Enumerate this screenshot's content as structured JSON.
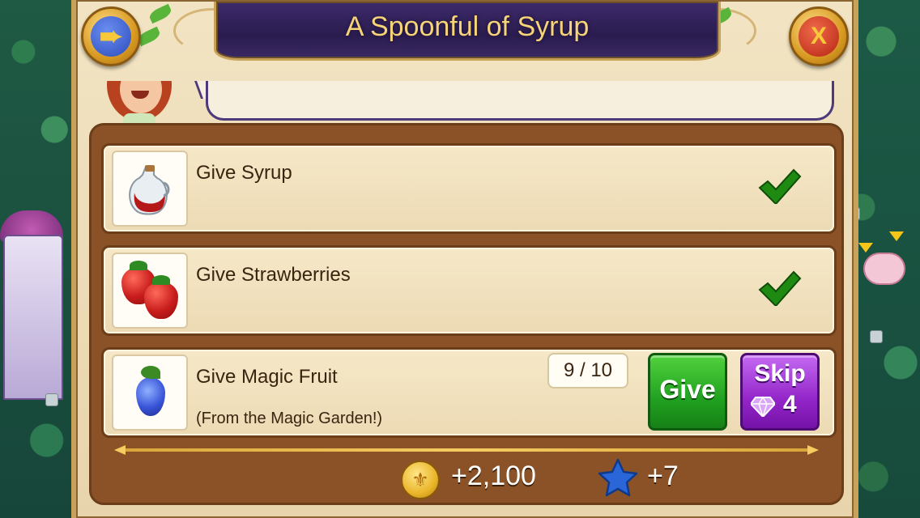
{
  "title": "A Spoonful of Syrup",
  "buttons": {
    "back_icon": "back-arrow-icon",
    "close_label": "X"
  },
  "tasks": [
    {
      "label": "Give Syrup",
      "item_icon": "syrup-bottle-icon",
      "completed": true
    },
    {
      "label": "Give Strawberries",
      "item_icon": "strawberries-icon",
      "completed": true
    },
    {
      "label": "Give Magic Fruit",
      "subtitle": "(From the Magic Garden!)",
      "item_icon": "magic-fruit-icon",
      "completed": false,
      "progress": "9 / 10",
      "give_label": "Give",
      "skip_label": "Skip",
      "skip_cost": "4"
    }
  ],
  "rewards": {
    "coins": "+2,100",
    "xp": "+7"
  },
  "colors": {
    "title_bar": "#2a1c4f",
    "title_text": "#f6d479",
    "panel": "#8a5226",
    "task_bg": "#f2e2bf",
    "give_button": "#21a120",
    "skip_button": "#9426c9",
    "check": "#1f8a12"
  }
}
